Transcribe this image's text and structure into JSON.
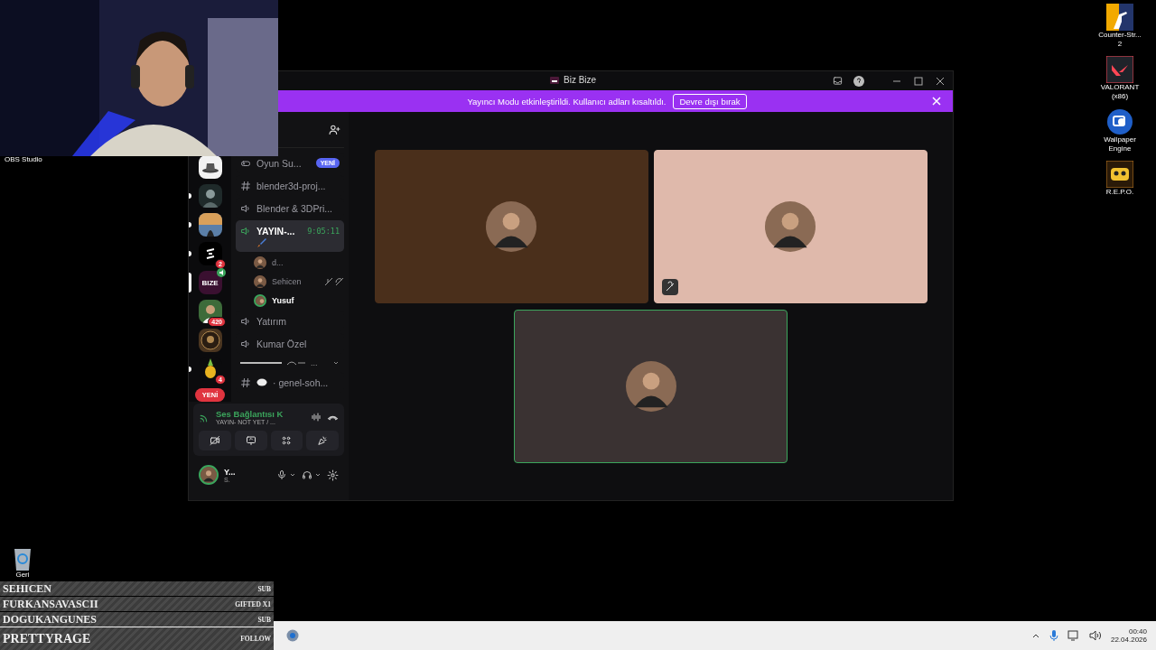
{
  "webcam": {
    "label": "OBS Studio"
  },
  "desktop_icons": [
    {
      "kind": "cs",
      "lines": [
        "Counter-Str...",
        "2"
      ]
    },
    {
      "kind": "valorant",
      "lines": [
        "VALORANT",
        "(x86)"
      ]
    },
    {
      "kind": "wallpaper",
      "lines": [
        "Wallpaper",
        "Engine"
      ]
    },
    {
      "kind": "repo",
      "lines": [
        "R.E.P.O."
      ]
    }
  ],
  "recycle_bin": {
    "label": "Geri"
  },
  "window": {
    "title": "Biz Bize",
    "banner": {
      "text": "Yayıncı Modu etkinleştirildi. Kullanıcı adları kısaltıldı.",
      "button": "Devre dışı bırak"
    }
  },
  "servers": [
    {
      "kind": "hat",
      "selected": false,
      "unread": false
    },
    {
      "kind": "dark",
      "selected": false,
      "unread": true
    },
    {
      "kind": "sky",
      "selected": false,
      "unread": true
    },
    {
      "kind": "logo",
      "selected": false,
      "unread": true,
      "badge": "2"
    },
    {
      "kind": "bize",
      "label": "BIZE",
      "selected": true,
      "unread": false,
      "voice": true
    },
    {
      "kind": "green",
      "selected": false,
      "unread": false,
      "badge": "420"
    },
    {
      "kind": "emblem",
      "selected": false,
      "unread": false
    },
    {
      "kind": "plant",
      "selected": false,
      "unread": true,
      "badge": "4"
    }
  ],
  "servers_new": "YENİ",
  "channels": [
    {
      "kind": "stage",
      "name": "Oyun Su...",
      "badge": "YENİ",
      "active": false
    },
    {
      "kind": "text",
      "name": "blender3d-proj...",
      "active": false
    },
    {
      "kind": "voice",
      "name": "Blender & 3DPri...",
      "active": false
    },
    {
      "kind": "voice",
      "name": "YAYIN-...",
      "timer": "9:05:11",
      "active": true,
      "children": [
        {
          "name": "d...",
          "speaking": false,
          "muted": false
        },
        {
          "name": "Sehicen",
          "speaking": false,
          "muted": true
        },
        {
          "name": "Yusuf",
          "speaking": true,
          "muted": false
        }
      ]
    },
    {
      "kind": "voice",
      "name": "Yatırım",
      "active": false
    },
    {
      "kind": "voice",
      "name": "Kumar Özel",
      "active": false
    },
    {
      "kind": "category",
      "name": "..."
    },
    {
      "kind": "text",
      "name": "· genel-soh...",
      "active": false
    }
  ],
  "voice_panel": {
    "status": "Ses Bağlantısı K",
    "channel": "YAYIN- NOT YET / ..."
  },
  "user": {
    "name": "Y...",
    "status": "S."
  },
  "video_tiles": [
    {
      "color": "#4a2f1b",
      "speaking": false,
      "muted": false
    },
    {
      "color": "#dfb9ab",
      "speaking": false,
      "muted": true
    },
    {
      "color": "#3a3232",
      "speaking": true,
      "muted": false
    }
  ],
  "alerts": [
    {
      "kind": "history",
      "name": "SEHICEN",
      "type": "SUB"
    },
    {
      "kind": "history",
      "name": "FURKANSAVASCII",
      "type": "GIFTED X1"
    },
    {
      "kind": "history",
      "name": "DOGUKANGUNES",
      "type": "SUB"
    },
    {
      "kind": "latest",
      "name": "PRETTYRAGE",
      "type": "FOLLOW"
    }
  ],
  "taskbar": {
    "time": "00:40",
    "date": "22.04.2026"
  }
}
